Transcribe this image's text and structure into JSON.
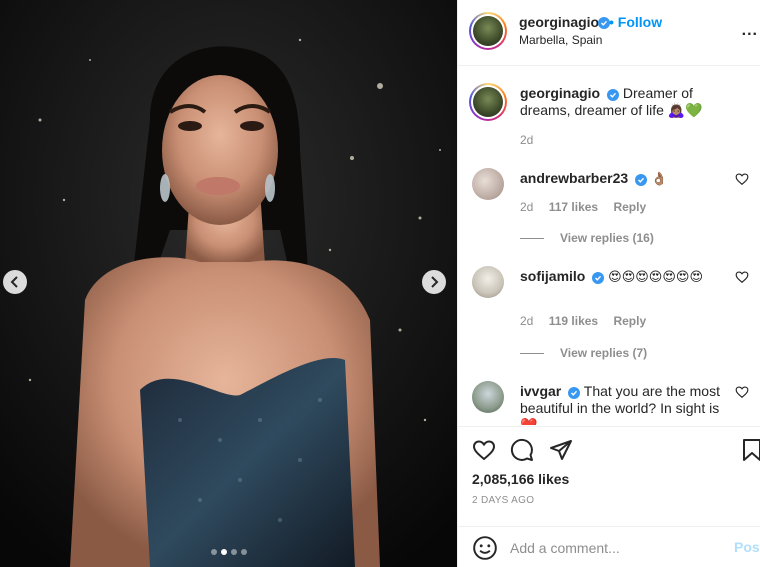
{
  "post": {
    "author": "georginagio",
    "follow_label": "Follow",
    "separator": "•",
    "location": "Marbella, Spain",
    "more_label": "...",
    "caption": {
      "author": "georginagio",
      "text": "Dreamer of dreams, dreamer of life 🙇🏽‍♀️💚",
      "time": "2d"
    },
    "carousel": {
      "total": 4,
      "active_index": 1
    }
  },
  "comments": [
    {
      "username": "andrewbarber23",
      "verified": true,
      "text": "👌🏽",
      "time": "2d",
      "likes": "117 likes",
      "reply_label": "Reply",
      "view_replies": "View replies (16)"
    },
    {
      "username": "sofijamilo",
      "verified": true,
      "text": "😍😍😍😍😍😍😍",
      "time": "2d",
      "likes": "119 likes",
      "reply_label": "Reply",
      "view_replies": "View replies (7)"
    },
    {
      "username": "ivvgar",
      "verified": true,
      "text": "That you are the most beautiful in the world? In sight is ❤️"
    }
  ],
  "footer": {
    "likes": "2,085,166 likes",
    "date": "2 DAYS AGO",
    "comment_placeholder": "Add a comment...",
    "post_label": "Post"
  },
  "colors": {
    "accent": "#0095f6",
    "verified": "#3897f0",
    "muted": "#8e8e8e",
    "post_disabled": "#b2dffc"
  },
  "icons": {
    "like": "heart-outline-icon",
    "comment": "comment-bubble-icon",
    "share": "paper-plane-icon",
    "save": "bookmark-icon",
    "emoji": "smiley-icon",
    "verified": "verified-badge-icon",
    "prev": "chevron-left-icon",
    "next": "chevron-right-icon"
  }
}
